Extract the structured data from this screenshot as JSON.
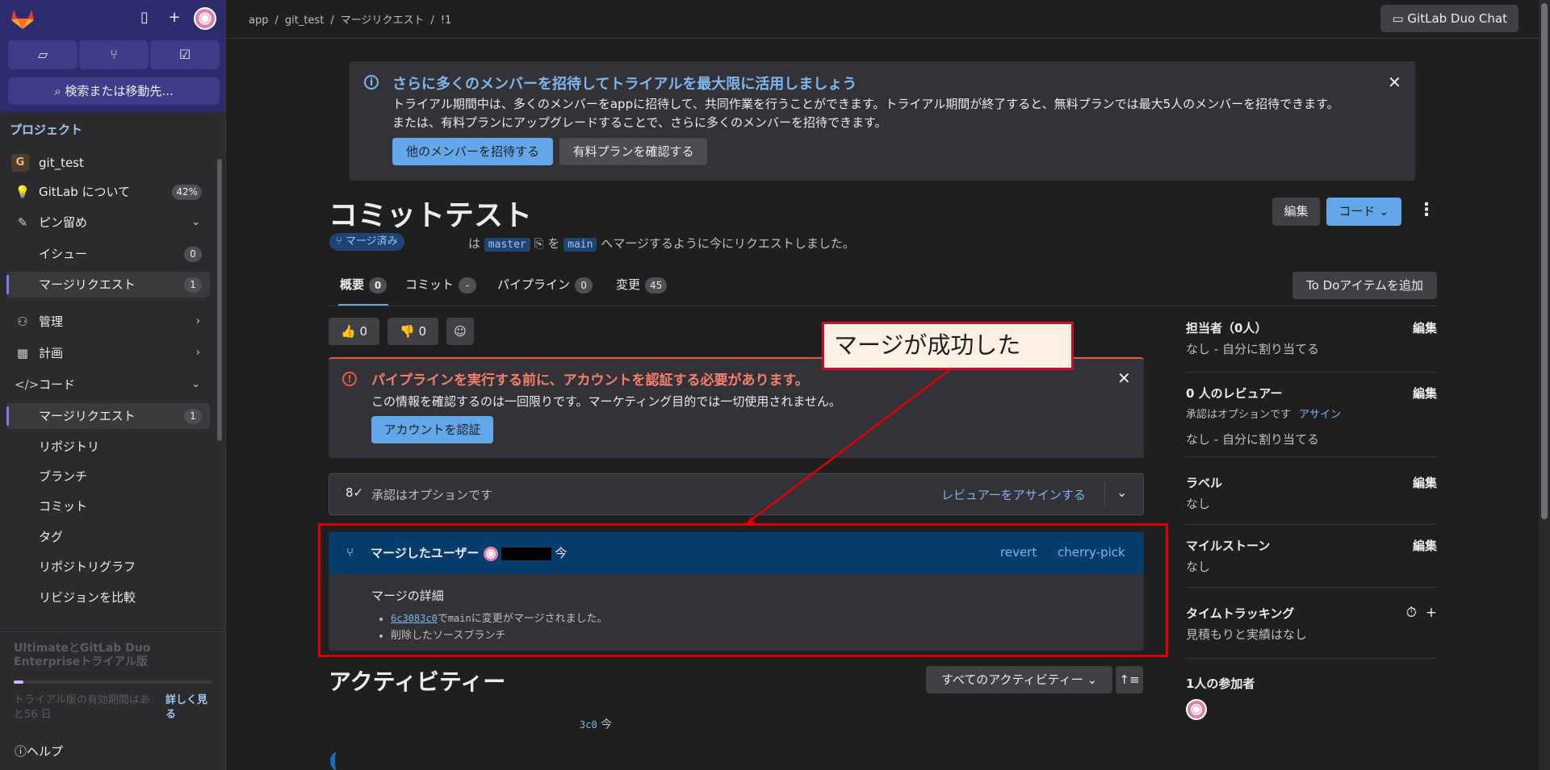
{
  "sidebar": {
    "search_label": "検索または移動先...",
    "section_title": "プロジェクト",
    "project_initial": "G",
    "items": [
      {
        "label": "git_test"
      },
      {
        "label": "GitLab について",
        "count": "42%"
      },
      {
        "label": "ピン留め"
      },
      {
        "label": "イシュー",
        "count": "0"
      },
      {
        "label": "マージリクエスト",
        "count": "1"
      },
      {
        "label": "管理"
      },
      {
        "label": "計画"
      },
      {
        "label": "コード"
      },
      {
        "label": "マージリクエスト",
        "count": "1"
      },
      {
        "label": "リポジトリ"
      },
      {
        "label": "ブランチ"
      },
      {
        "label": "コミット"
      },
      {
        "label": "タグ"
      },
      {
        "label": "リポジトリグラフ"
      },
      {
        "label": "リビジョンを比較"
      }
    ],
    "trial_title": "UltimateとGitLab Duo Enterpriseトライアル版",
    "trial_text": "トライアル版の有効期間はあと56 日",
    "trial_link": "詳しく見る",
    "trial_progress": 0.05,
    "help_label": "ヘルプ"
  },
  "breadcrumb": [
    "app",
    "/",
    "git_test",
    "/",
    "マージリクエスト",
    "/",
    "!1"
  ],
  "duo_chat_label": "GitLab Duo Chat",
  "banner": {
    "title": "さらに多くのメンバーを招待してトライアルを最大限に活用しましょう",
    "text1": "トライアル期間中は、多くのメンバーをappに招待して、共同作業を行うことができます。トライアル期間が終了すると、無料プランでは最大5人のメンバーを招待できます。",
    "text2": "または、有料プランにアップグレードすることで、さらに多くのメンバーを招待できます。",
    "invite_button": "他のメンバーを招待する",
    "plan_button": "有料プランを確認する"
  },
  "mr": {
    "title": "コミットテスト",
    "status_badge": "マージ済み",
    "meta_pre": "は",
    "source_branch": "master",
    "meta_mid": "を",
    "target_branch": "main",
    "meta_post": "へマージするように今にリクエストしました。",
    "edit_button": "編集",
    "code_button": "コード",
    "todo_button": "To Doアイテムを追加"
  },
  "tabs": [
    {
      "label": "概要",
      "count": "0"
    },
    {
      "label": "コミット",
      "count": "-"
    },
    {
      "label": "パイプライン",
      "count": "0"
    },
    {
      "label": "変更",
      "count": "45"
    }
  ],
  "reactions": {
    "thumbs_up": "0",
    "thumbs_down": "0"
  },
  "alert": {
    "title": "パイプラインを実行する前に、アカウントを認証する必要があります。",
    "text": "この情報を確認するのは一回限りです。マーケティング目的では一切使用されません。",
    "button": "アカウントを認証"
  },
  "approval": {
    "text": "承認はオプションです",
    "link": "レビュアーをアサインする"
  },
  "merged": {
    "header": "マージしたユーザー",
    "when": "今",
    "revert": "revert",
    "cherry_pick": "cherry-pick",
    "details_title": "マージの詳細",
    "sha": "6c3083c0",
    "detail1_mid": "で",
    "detail1_branch": "main",
    "detail1_post": "に変更がマージされました。",
    "detail2": "削除したソースブランチ"
  },
  "callout_text": "マージが成功した",
  "activity": {
    "title": "アクティビティー",
    "filter": "すべてのアクティビティー",
    "line_sha": "3c0",
    "line_when": "今"
  },
  "right_sidebar": {
    "assignee_label": "担当者（0人）",
    "assignee_value": "なし - 自分に割り当てる",
    "reviewer_label": "0 人のレビュアー",
    "reviewer_sub": "承認はオプションです",
    "reviewer_assign": "アサイン",
    "reviewer_value": "なし - 自分に割り当てる",
    "labels_label": "ラベル",
    "labels_value": "なし",
    "milestone_label": "マイルストーン",
    "milestone_value": "なし",
    "time_label": "タイムトラッキング",
    "time_value": "見積もりと実績はなし",
    "participants_label": "1人の参加者",
    "edit_label": "編集"
  },
  "colors": {
    "accent": "#63a6e9",
    "alert": "#ec5941",
    "annotation_red": "#e10000",
    "sidebar_top": "#2d2b6e"
  }
}
